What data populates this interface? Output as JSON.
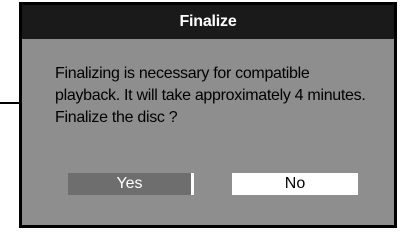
{
  "dialog": {
    "title": "Finalize",
    "message_lines": [
      "Finalizing is necessary for compatible",
      "playback. It will take approximately 4 minutes.",
      "Finalize the disc ?"
    ],
    "buttons": {
      "yes_label": "Yes",
      "no_label": "No",
      "selected": "No"
    }
  },
  "colors": {
    "title_bar": "#1a1a1a",
    "dialog_body": "#8e8e8e",
    "yes_button": "#6e6e6e",
    "no_button": "#ffffff"
  }
}
